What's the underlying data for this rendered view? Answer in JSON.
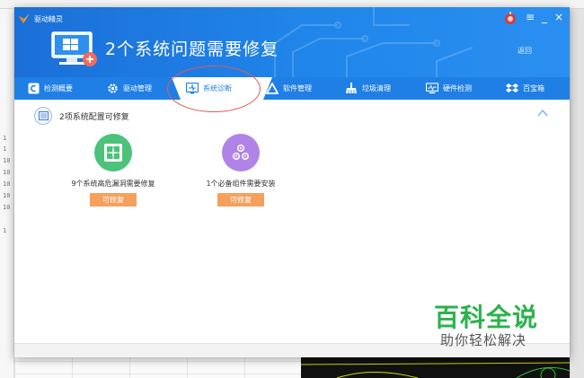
{
  "app": {
    "name": "驱动精灵",
    "header_title": "2个系统问题需要修复",
    "back_label": "返回",
    "accent_color": "#1f7fe4",
    "button_color": "#f5a05c"
  },
  "window_controls": {
    "menu_glyph": "≡",
    "minimize_glyph": "_",
    "close_glyph": "×"
  },
  "tabs": [
    {
      "label": "检测概要",
      "icon": "c-icon"
    },
    {
      "label": "驱动管理",
      "icon": "gear-icon"
    },
    {
      "label": "系统诊断",
      "icon": "diagnose-icon",
      "active": true
    },
    {
      "label": "软件管理",
      "icon": "triangle-icon"
    },
    {
      "label": "垃圾清理",
      "icon": "broom-icon"
    },
    {
      "label": "硬件检测",
      "icon": "monitor-icon"
    },
    {
      "label": "百宝箱",
      "icon": "box-icon"
    }
  ],
  "section": {
    "title": "2项系统配置可修复"
  },
  "items": [
    {
      "label": "9个系统高危漏洞需要修复",
      "button": "可修复",
      "color": "#4cc27a",
      "icon": "shield-windows-icon"
    },
    {
      "label": "1个必备组件需要安装",
      "button": "可修复",
      "color": "#b084e6",
      "icon": "components-icon"
    }
  ],
  "background": {
    "row_numbers": [
      "1",
      "1",
      "10",
      "10",
      "10",
      "10",
      "10",
      "1"
    ]
  },
  "watermark": {
    "line1": "百科全说",
    "line2": "助你轻松解决",
    "color": "#2bb24c"
  }
}
